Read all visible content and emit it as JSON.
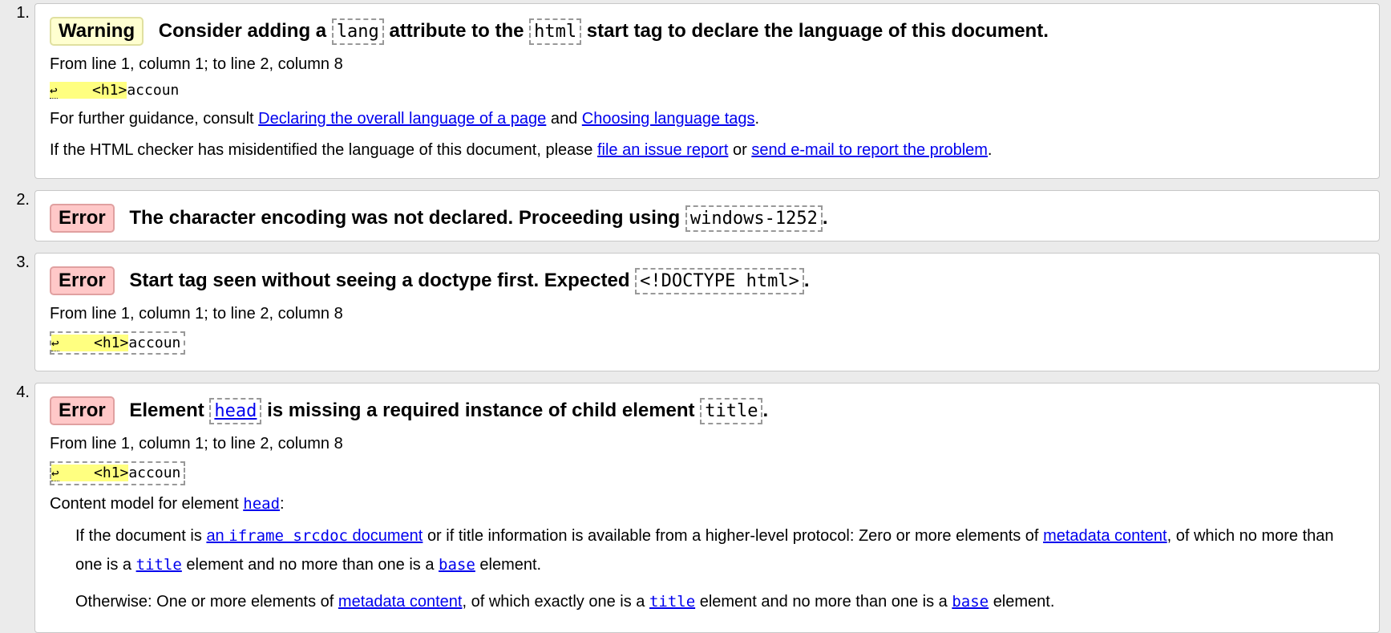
{
  "messages": [
    {
      "num": "1.",
      "badge": "Warning",
      "t1": "Consider adding a",
      "c1": "lang",
      "t2": "attribute to the",
      "c2": "html",
      "t3": "start tag to declare the language of this document.",
      "location": "From line 1, column 1; to line 2, column 8",
      "extract_lf": "↩",
      "extract_hl": "    <h1>",
      "extract_tail": "accoun",
      "guidance_prefix": "For further guidance, consult",
      "guidance_link1": "Declaring the overall language of a page",
      "guidance_and": "and",
      "guidance_link2": "Choosing language tags",
      "guidance_end": ".",
      "report_prefix": "If the HTML checker has misidentified the language of this document, please",
      "report_link1": "file an issue report",
      "report_or": "or",
      "report_link2": "send e-mail to report the problem",
      "report_end": "."
    },
    {
      "num": "2.",
      "badge": "Error",
      "t1": "The character encoding was not declared. Proceeding using",
      "c1": "windows-1252",
      "t2": "."
    },
    {
      "num": "3.",
      "badge": "Error",
      "t1": "Start tag seen without seeing a doctype first. Expected",
      "c1": "<!DOCTYPE html>",
      "t2": ".",
      "location": "From line 1, column 1; to line 2, column 8",
      "extract_lf": "↩",
      "extract_hl": "    <h1>",
      "extract_tail": "accoun"
    },
    {
      "num": "4.",
      "badge": "Error",
      "t1": "Element",
      "c1_link": "head",
      "t2": "is missing a required instance of child element",
      "c2": "title",
      "t3": ".",
      "location": "From line 1, column 1; to line 2, column 8",
      "extract_lf": "↩",
      "extract_hl": "    <h1>",
      "extract_tail": "accoun",
      "cm_label": "Content model for element",
      "cm_element": "head",
      "cm_colon": ":",
      "cm1_a": "If the document is",
      "cm1_link1": "an",
      "cm1_link1_code": "iframe srcdoc",
      "cm1_link1_tail": "document",
      "cm1_b": "or if title information is available from a higher-level protocol: Zero or more elements of",
      "cm1_link2": "metadata content",
      "cm1_c": ", of which no more than one is a",
      "cm1_link3": "title",
      "cm1_d": "element and no more than one is a",
      "cm1_link4": "base",
      "cm1_e": "element.",
      "cm2_a": "Otherwise: One or more elements of",
      "cm2_link1": "metadata content",
      "cm2_b": ", of which exactly one is a",
      "cm2_link2": "title",
      "cm2_c": "element and no more than one is a",
      "cm2_link3": "base",
      "cm2_d": "element."
    }
  ]
}
